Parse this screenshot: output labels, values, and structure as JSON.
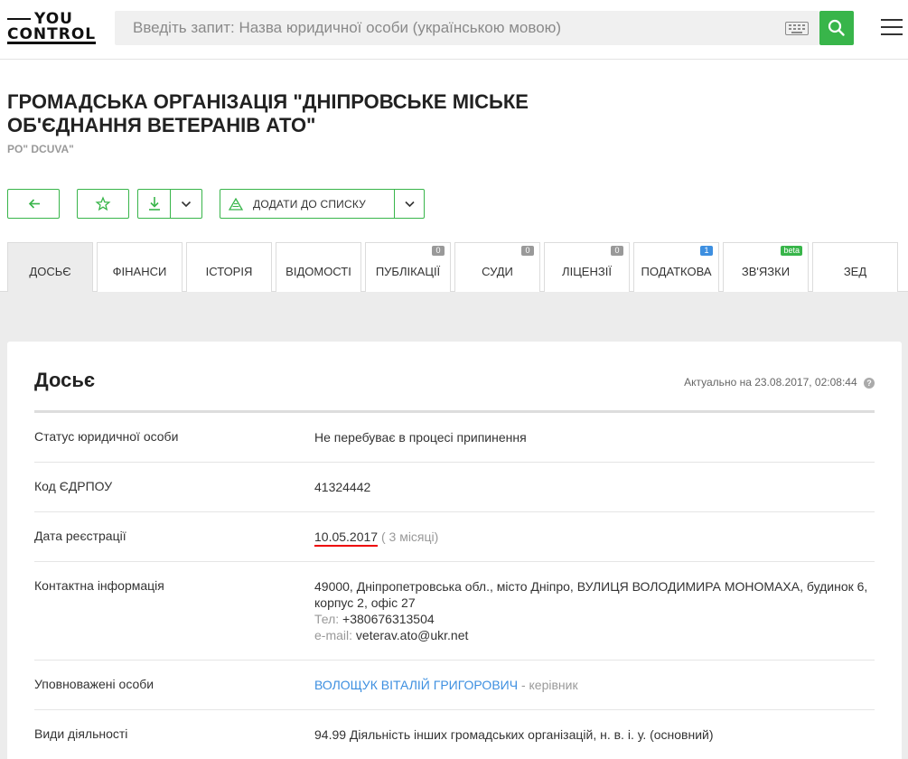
{
  "header": {
    "logo_line1": "YOU",
    "logo_line2": "CONTROL",
    "search_placeholder": "Введіть запит: Назва юридичної особи (українською мовою)",
    "keyboard_icon": "keyboard-icon",
    "search_icon": "search-icon",
    "menu_icon": "hamburger-menu-icon",
    "accent_color": "#38b54a"
  },
  "company": {
    "title": "ГРОМАДСЬКА ОРГАНІЗАЦІЯ \"ДНІПРОВСЬКЕ МІСЬКЕ ОБ'ЄДНАННЯ ВЕТЕРАНІВ АТО\"",
    "subtitle": "PO\" DCUVA\""
  },
  "actions": {
    "add_to_list_label": "ДОДАТИ ДО СПИСКУ"
  },
  "tabs": [
    {
      "label": "ДОСЬЄ",
      "active": true
    },
    {
      "label": "ФІНАНСИ"
    },
    {
      "label": "ІСТОРІЯ"
    },
    {
      "label": "ВІДОМОСТІ"
    },
    {
      "label": "ПУБЛІКАЦІЇ",
      "badge": "0"
    },
    {
      "label": "СУДИ",
      "badge": "0"
    },
    {
      "label": "ЛІЦЕНЗІЇ",
      "badge": "0"
    },
    {
      "label": "ПОДАТКОВА",
      "badge": "1"
    },
    {
      "label": "ЗВ'ЯЗКИ",
      "badge": "beta"
    },
    {
      "label": "ЗЕД"
    }
  ],
  "dossier": {
    "heading": "Досьє",
    "actual": "Актуально на 23.08.2017, 02:08:44",
    "help": "?",
    "rows": {
      "status": {
        "label": "Статус юридичної особи",
        "value": "Не перебуває в процесі припинення"
      },
      "code": {
        "label": "Код ЄДРПОУ",
        "value": "41324442"
      },
      "regdate": {
        "label": "Дата реєстрації",
        "date": "10.05.2017",
        "age": "( 3 місяці)"
      },
      "contacts": {
        "label": "Контактна інформація",
        "address": "49000, Дніпропетровська обл., місто Дніпро, ВУЛИЦЯ ВОЛОДИМИРА МОНОМАХА, будинок 6, корпус 2, офіс 27",
        "tel_label": "Тел:",
        "tel": "+380676313504",
        "email_label": "e-mail:",
        "email": "veterav.ato@ukr.net"
      },
      "persons": {
        "label": "Уповноважені особи",
        "name": "ВОЛОЩУК ВІТАЛІЙ ГРИГОРОВИЧ",
        "role": "- керівник"
      },
      "activity": {
        "label": "Види діяльності",
        "value": "94.99 Діяльність інших громадських організацій, н. в. і. у. (основний)"
      }
    }
  }
}
